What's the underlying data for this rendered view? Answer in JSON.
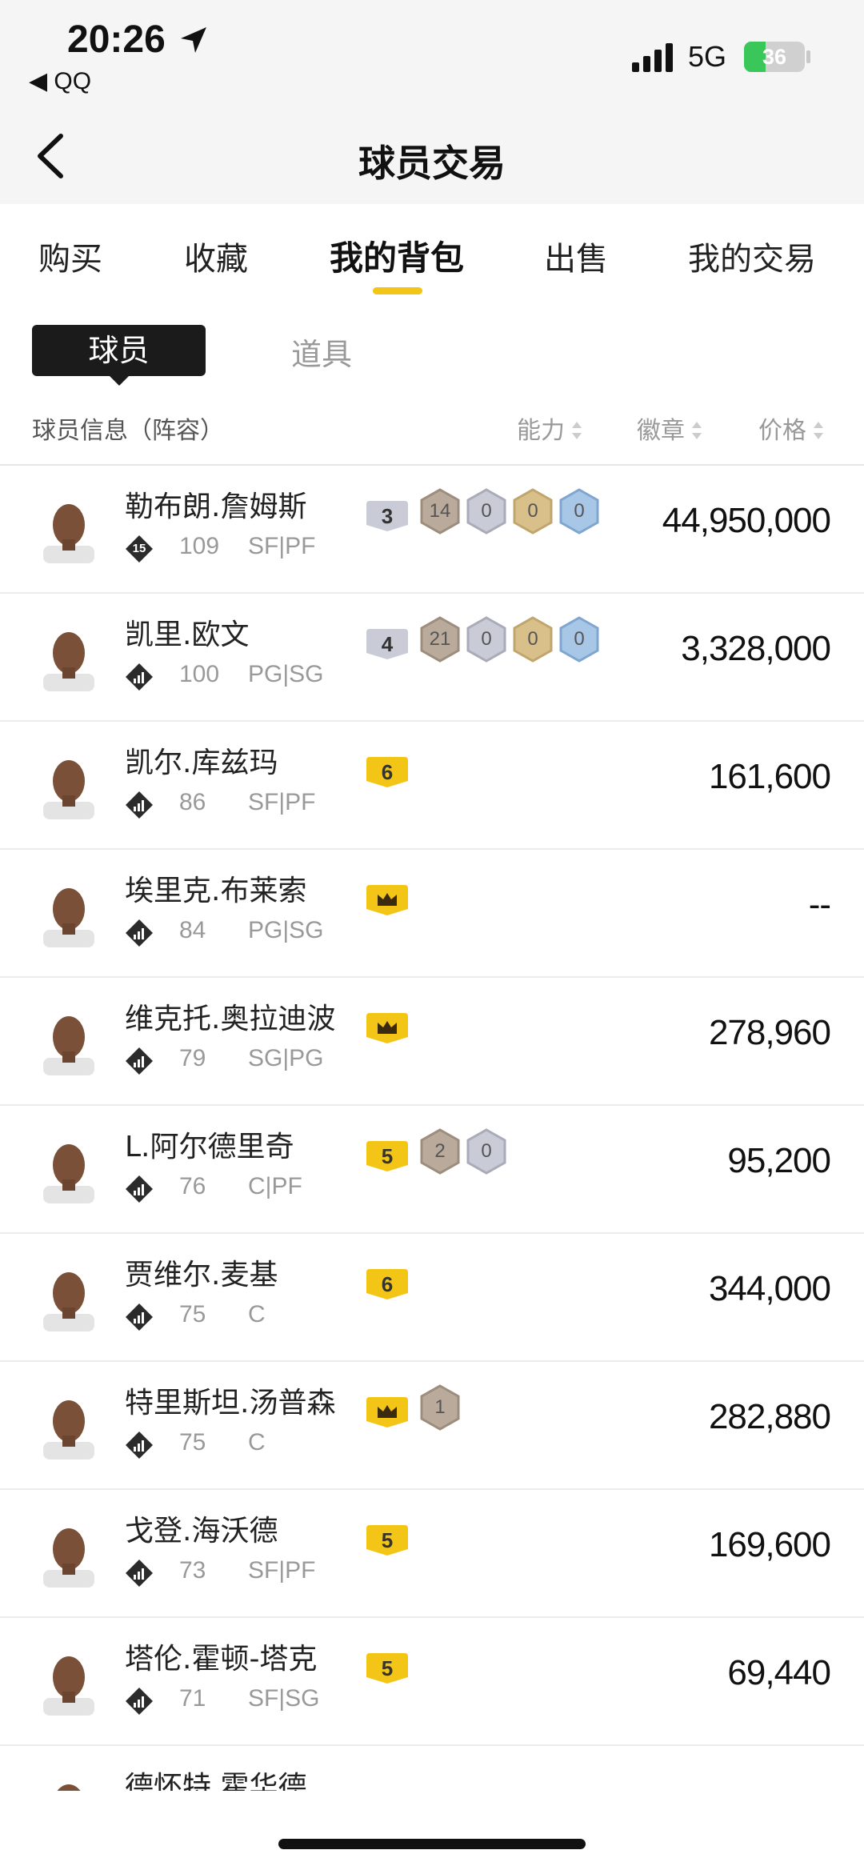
{
  "status_bar": {
    "time": "20:26",
    "back_app": "◀ QQ",
    "network": "5G",
    "battery": "36",
    "battery_level": 0.36,
    "battery_color": "#39c759"
  },
  "nav": {
    "title": "球员交易",
    "back_icon": "chevron-left-icon"
  },
  "tabs": [
    {
      "label": "购买",
      "active": false
    },
    {
      "label": "收藏",
      "active": false
    },
    {
      "label": "我的背包",
      "active": true
    },
    {
      "label": "出售",
      "active": false
    },
    {
      "label": "我的交易",
      "active": false
    }
  ],
  "subtabs": [
    {
      "label": "球员",
      "active": true
    },
    {
      "label": "道具",
      "active": false
    }
  ],
  "columns": {
    "info": "球员信息（阵容）",
    "ability": "能力",
    "badge": "徽章",
    "price": "价格"
  },
  "accent_color": "#f3c516",
  "players": [
    {
      "name": "勒布朗.詹姆斯",
      "rank": "15",
      "rating": "109",
      "pos": "SF|PF",
      "level": "3",
      "badges": [
        "14",
        "0",
        "0",
        "0"
      ],
      "price": "44,950,000"
    },
    {
      "name": "凯里.欧文",
      "rank": "",
      "rating": "100",
      "pos": "PG|SG",
      "level": "4",
      "badges": [
        "21",
        "0",
        "0",
        "0"
      ],
      "price": "3,328,000"
    },
    {
      "name": "凯尔.库兹玛",
      "rank": "",
      "rating": "86",
      "pos": "SF|PF",
      "level": "6",
      "badges": [],
      "price": "161,600"
    },
    {
      "name": "埃里克.布莱索",
      "rank": "",
      "rating": "84",
      "pos": "PG|SG",
      "level": "crown",
      "badges": [],
      "price": "--"
    },
    {
      "name": "维克托.奥拉迪波",
      "rank": "",
      "rating": "79",
      "pos": "SG|PG",
      "level": "crown",
      "badges": [],
      "price": "278,960"
    },
    {
      "name": "L.阿尔德里奇",
      "rank": "",
      "rating": "76",
      "pos": "C|PF",
      "level": "5",
      "badges": [
        "2",
        "0"
      ],
      "price": "95,200"
    },
    {
      "name": "贾维尔.麦基",
      "rank": "",
      "rating": "75",
      "pos": "C",
      "level": "6",
      "badges": [],
      "price": "344,000"
    },
    {
      "name": "特里斯坦.汤普森",
      "rank": "",
      "rating": "75",
      "pos": "C",
      "level": "crown",
      "badges": [
        "1"
      ],
      "price": "282,880"
    },
    {
      "name": "戈登.海沃德",
      "rank": "",
      "rating": "73",
      "pos": "SF|PF",
      "level": "5",
      "badges": [],
      "price": "169,600"
    },
    {
      "name": "塔伦.霍顿-塔克",
      "rank": "",
      "rating": "71",
      "pos": "SF|SG",
      "level": "5",
      "badges": [],
      "price": "69,440"
    },
    {
      "name": "德怀特.霍华德",
      "rank": "",
      "rating": "",
      "pos": "",
      "level": "",
      "badges": [],
      "price": ""
    }
  ]
}
